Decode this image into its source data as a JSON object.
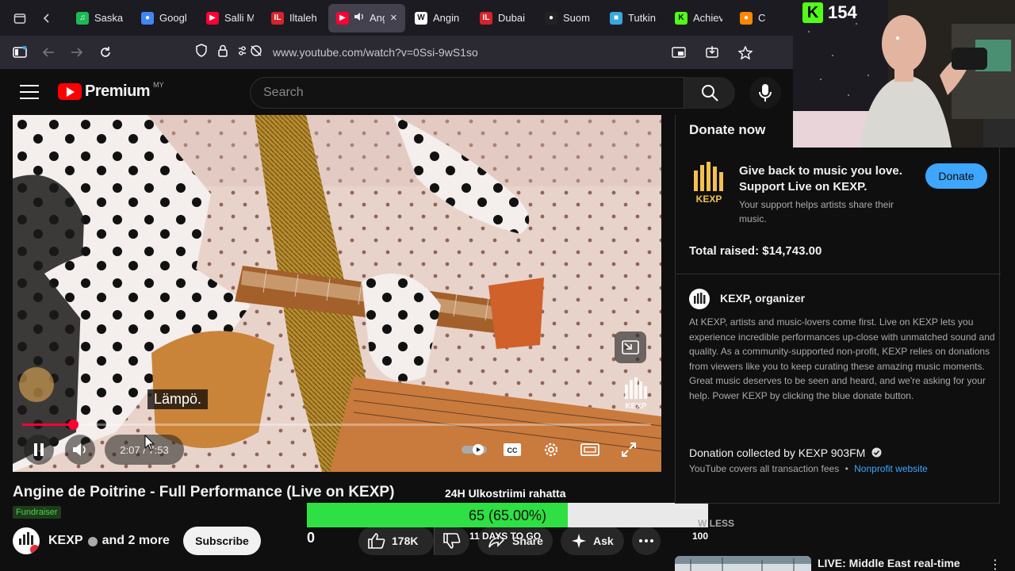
{
  "browser": {
    "tabs": [
      {
        "label": "Saska",
        "color": "#1db954",
        "glyph": "♫"
      },
      {
        "label": "Googl",
        "color": "#4285f4",
        "glyph": "●"
      },
      {
        "label": "Salli M",
        "color": "#ff0033",
        "glyph": "▶"
      },
      {
        "label": "Iltaleh",
        "color": "#d8232a",
        "glyph": "IL"
      },
      {
        "label": "Ang",
        "color": "#ff0033",
        "glyph": "▶",
        "active": true
      },
      {
        "label": "Angin",
        "color": "#ffffff",
        "glyph": "W"
      },
      {
        "label": "Dubai",
        "color": "#d8232a",
        "glyph": "IL"
      },
      {
        "label": "Suom",
        "color": "#222222",
        "glyph": "●"
      },
      {
        "label": "Tutkin",
        "color": "#3aa8e0",
        "glyph": "■"
      },
      {
        "label": "Achiev",
        "color": "#53fc18",
        "glyph": "K"
      },
      {
        "label": "Crea",
        "color": "#ff8800",
        "glyph": "●"
      }
    ],
    "url": "www.youtube.com/watch?v=0Ssi-9wS1so"
  },
  "youtube": {
    "brand": "Premium",
    "country_code": "MY",
    "search_placeholder": "Search"
  },
  "player": {
    "caption": "Lämpö.",
    "current_time": "2:07",
    "duration": "7:53",
    "progress_fraction": 0.081
  },
  "video": {
    "title": "Angine de Poitrine - Full Performance (Live on KEXP)",
    "badge": "Fundraiser",
    "channel": "KEXP",
    "collaborators": "and 2 more",
    "subscribe_label": "Subscribe",
    "likes": "178K",
    "share_label": "Share",
    "ask_label": "Ask"
  },
  "stream_overlay": {
    "title": "24H Ulkostriimi rahatta",
    "goal_text": "65 (65.00%)",
    "goal_fraction": 0.65,
    "min_label": "0",
    "days_label": "11 DAYS TO GO",
    "max_label": "100"
  },
  "donation_panel": {
    "heading": "Donate now",
    "lead": "Give back to music you love. Support Live on KEXP.",
    "sub": "Your support helps artists share their music.",
    "donate_label": "Donate",
    "total_raised": "Total raised: $14,743.00",
    "organizer": "KEXP, organizer",
    "description": "At KEXP, artists and music-lovers come first. Live on KEXP lets you experience incredible performances up-close with unmatched sound and quality. As a community-supported non-profit, KEXP relies on donations from viewers like you to keep curating these amazing music moments. Great music deserves to be seen and heard, and we're asking for your help. Power KEXP by clicking the blue donate button.",
    "collected_by": "Donation collected by KEXP 903FM",
    "fees_text": "YouTube covers all transaction fees",
    "fees_link": "Nonprofit website",
    "show_less": "W LESS"
  },
  "recommendation": {
    "title": "LIVE: Middle East real-time"
  },
  "streamer": {
    "viewer_count": "154",
    "platform_glyph": "K"
  }
}
